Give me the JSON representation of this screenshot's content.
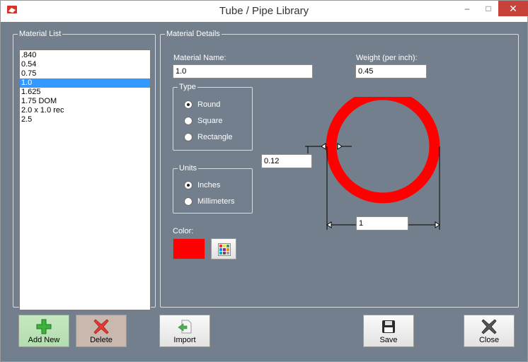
{
  "window": {
    "title": "Tube / Pipe  Library",
    "controls": {
      "minimize": "–",
      "maximize": "□",
      "close": "✕"
    }
  },
  "material_list": {
    "legend": "Material List",
    "items": [
      ".840",
      "0.54",
      "0.75",
      "1.0",
      "1.625",
      "1.75 DOM",
      "2.0 x 1.0 rec",
      "2.5"
    ],
    "selected_index": 3
  },
  "details": {
    "legend": "Material Details",
    "name_label": "Material Name:",
    "name_value": "1.0",
    "weight_label": "Weight (per inch):",
    "weight_value": "0.45",
    "type": {
      "legend": "Type",
      "options": [
        "Round",
        "Square",
        "Rectangle"
      ],
      "selected": "Round"
    },
    "units": {
      "legend": "Units",
      "options": [
        "Inches",
        "Millimeters"
      ],
      "selected": "Inches"
    },
    "color_label": "Color:",
    "color_value": "#ff0000",
    "wall_thickness": "0.12",
    "diameter": "1"
  },
  "buttons": {
    "add_new": "Add New",
    "delete": "Delete",
    "import": "Import",
    "save": "Save",
    "close": "Close"
  },
  "icons": {
    "app": "app-logo-icon",
    "add": "plus-icon",
    "delete": "x-icon",
    "import": "import-arrow-icon",
    "save": "floppy-disk-icon",
    "close": "x-icon",
    "palette": "color-palette-icon"
  }
}
